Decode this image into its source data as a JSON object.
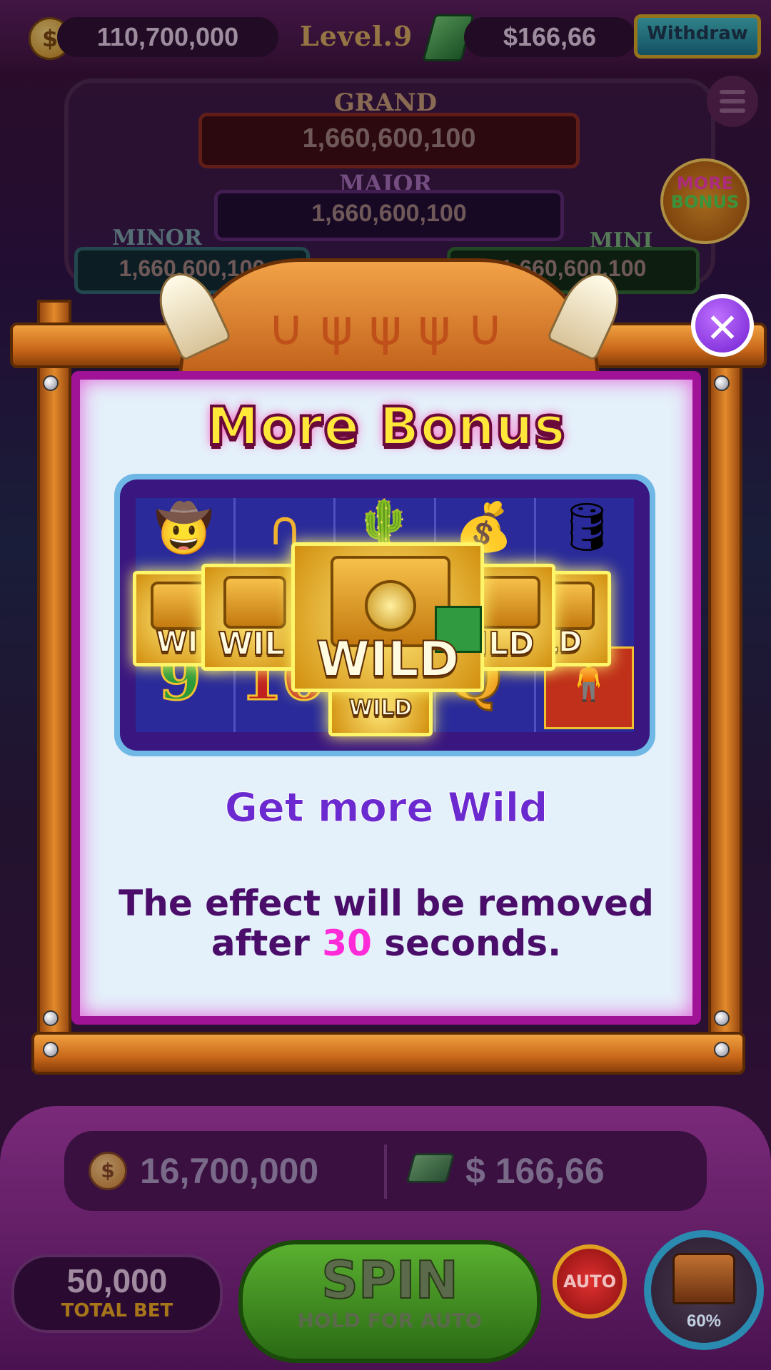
{
  "top_bar": {
    "coin_symbol": "$",
    "coins": "110,700,000",
    "level_label": "Level.9",
    "cash": "$166,66",
    "withdraw_label": "Withdraw"
  },
  "jackpots": {
    "grand": {
      "label": "GRAND",
      "value": "1,660,600,100"
    },
    "major": {
      "label": "MAJOR",
      "value": "1,660,600,100"
    },
    "minor": {
      "label": "MINOR",
      "value": "1,660,600,100"
    },
    "mini": {
      "label": "MINI",
      "value": "1,660,600,100"
    }
  },
  "badge": {
    "line1": "MORE",
    "line2": "BONUS"
  },
  "popup": {
    "title": "More Bonus",
    "subtitle": "Get more Wild",
    "desc_part1": "The effect will be removed after ",
    "desc_seconds": "30",
    "desc_part2": " seconds.",
    "close_glyph": "✕",
    "wild_label": "WILD",
    "wild_label_left1": "WI",
    "wild_label_left2": "WIL",
    "wild_label_right1": "ILD",
    "wild_label_right2": "LD",
    "symbol_9": "9",
    "symbol_10": "10",
    "symbol_q": "Q"
  },
  "bottom": {
    "coins": "16,700,000",
    "cash": "$ 166,66",
    "total_bet_value": "50,000",
    "total_bet_label": "TOTAL BET",
    "spin_label": "SPIN",
    "spin_sub": "HOLD FOR AUTO",
    "auto_label": "AUTO",
    "chest_percent": "60%"
  },
  "colors": {
    "title_fill": "#ffe83a",
    "highlight": "#ff2ad8",
    "subtitle": "#6a2ad0",
    "panel_border": "#a01296",
    "close_button": "#7020d0"
  },
  "icons": [
    "coin-icon",
    "cash-icon",
    "menu-icon",
    "close-icon",
    "chest-icon",
    "cowboy-hat-icon",
    "horseshoe-icon",
    "cactus-icon",
    "money-bag-icon",
    "barrel-icon",
    "safe-icon",
    "cowboy-icon"
  ]
}
